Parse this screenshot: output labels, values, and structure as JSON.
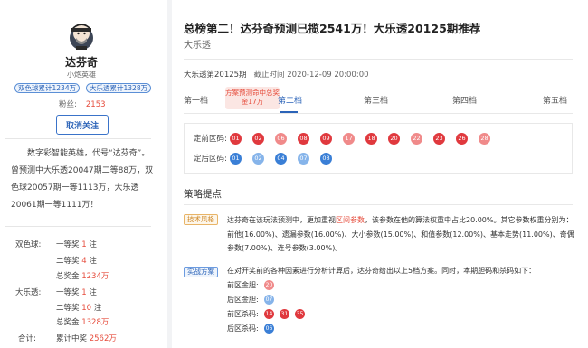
{
  "author": {
    "name": "达芬奇",
    "title": "小炮英雄",
    "tags": [
      "双色球累计1234万",
      "大乐透累计1328万"
    ],
    "fans_label": "粉丝:",
    "fans_count": "2153",
    "follow_button": "取消关注",
    "intro": "数字彩智能英雄，代号“达芬奇”。曾预测中大乐透20047期二等88万，双色球20057期一等1113万，大乐透20061期一等1111万！",
    "stats": [
      {
        "label": "双色球:",
        "prize": "一等奖",
        "value": "1",
        "unit": "注"
      },
      {
        "label": "",
        "prize": "二等奖",
        "value": "4",
        "unit": "注"
      },
      {
        "label": "",
        "prize": "总奖金",
        "value": "1234万",
        "unit": ""
      },
      {
        "label": "大乐透:",
        "prize": "一等奖",
        "value": "1",
        "unit": "注"
      },
      {
        "label": "",
        "prize": "二等奖",
        "value": "10",
        "unit": "注"
      },
      {
        "label": "",
        "prize": "总奖金",
        "value": "1328万",
        "unit": ""
      },
      {
        "label": "合计:",
        "prize": "累计中奖",
        "value": "2562万",
        "unit": ""
      }
    ]
  },
  "article": {
    "title": "总榜第二！达芬奇预测已揽2541万！大乐透20125期推荐",
    "subtitle": "大乐透",
    "period": "大乐透第20125期",
    "deadline": "截止时间 2020-12-09 20:00:00",
    "tabs": [
      "第一档",
      "第二档",
      "第三档",
      "第四档",
      "第五档"
    ],
    "tab_tip": "方案预测命中总奖金17万",
    "front_label": "定前区码:",
    "back_label": "定后区码:",
    "front_balls": [
      "01",
      "02",
      "06",
      "08",
      "09",
      "17",
      "18",
      "20",
      "22",
      "23",
      "26",
      "28"
    ],
    "back_balls": [
      "01",
      "02",
      "04",
      "07",
      "08"
    ],
    "section_title": "策略提点",
    "style_badge": "技术风格",
    "strategy_pre": "达芬奇在该玩法预测中，更加重视",
    "strategy_hl": "区间参数",
    "strategy_post": "，该参数在他的算法权重中占比20.00%。其它参数权重分别为：前他(16.00%)、遗漏参数(16.00%)、大小参数(15.00%)、和值参数(12.00%)、基本走势(11.00%)、奇偶参数(7.00%)、连号参数(3.00%)。",
    "plan_badge": "实战方案",
    "plan_text": "在对开奖前的各种因素进行分析计算后，达芬奇给出以上5档方案。同时，本期胆码和杀码如下：",
    "plan_rows": [
      {
        "label": "前区金胆:",
        "balls": [
          "20"
        ],
        "kind": "front"
      },
      {
        "label": "后区金胆:",
        "balls": [
          "07"
        ],
        "kind": "back"
      },
      {
        "label": "前区杀码:",
        "balls": [
          "14",
          "31",
          "35"
        ],
        "kind": "front"
      },
      {
        "label": "后区杀码:",
        "balls": [
          "06"
        ],
        "kind": "back"
      }
    ]
  },
  "colors": {
    "red_dark": "#e0393e",
    "red_light": "#f08a8a",
    "blue_dark": "#3a7fd6",
    "blue_light": "#86b4ea",
    "accent": "#2b63b8",
    "highlight": "#e64c3c"
  }
}
